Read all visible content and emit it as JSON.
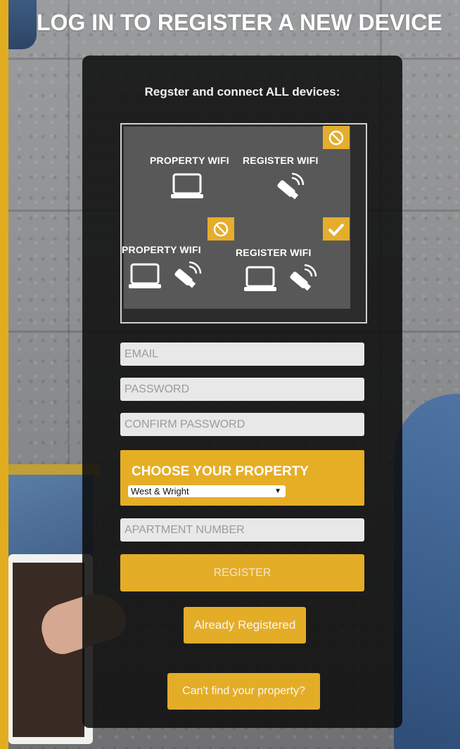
{
  "page": {
    "title": "LOG IN TO REGISTER A NEW DEVICE",
    "accent_color": "#e1ad1f"
  },
  "panel": {
    "subtitle": "Regster and connect ALL devices:"
  },
  "diagram": {
    "top_left_label": "PROPERTY WIFI",
    "top_right_label": "REGISTER WIFI",
    "bottom_left_label": "PROPERTY WIFI",
    "bottom_right_label": "REGISTER WIFI",
    "top_badge_icon": "prohibited-icon",
    "middle_left_badge_icon": "prohibited-icon",
    "middle_right_badge_icon": "checkmark-icon"
  },
  "form": {
    "email_placeholder": "EMAIL",
    "password_placeholder": "PASSWORD",
    "confirm_password_placeholder": "CONFIRM PASSWORD",
    "property_heading": "CHOOSE YOUR PROPERTY",
    "property_selected": "West & Wright",
    "apartment_placeholder": "APARTMENT NUMBER",
    "register_label": "REGISTER",
    "already_registered_label": "Already Registered",
    "cant_find_label": "Can't find your property?"
  }
}
